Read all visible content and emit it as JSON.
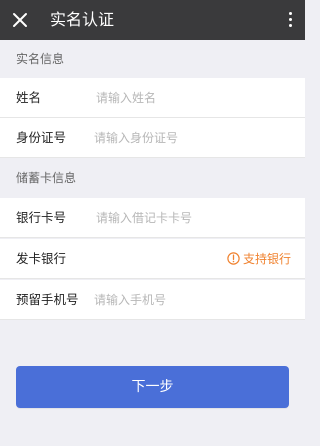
{
  "header": {
    "title": "实名认证"
  },
  "sections": {
    "identity_title": "实名信息",
    "card_title": "储蓄卡信息"
  },
  "fields": {
    "name_label": "姓名",
    "name_placeholder": "请输入姓名",
    "id_label": "身份证号",
    "id_placeholder": "请输入身份证号",
    "card_label": "银行卡号",
    "card_placeholder": "请输入借记卡卡号",
    "bank_label": "发卡银行",
    "phone_label": "预留手机号",
    "phone_placeholder": "请输入手机号"
  },
  "links": {
    "supported_banks": "支持银行"
  },
  "actions": {
    "next_label": "下一步"
  },
  "colors": {
    "header_bg": "#3a3a3c",
    "accent_orange": "#f0822f",
    "primary_button": "#4a6fd8",
    "page_bg": "#efeff4"
  }
}
